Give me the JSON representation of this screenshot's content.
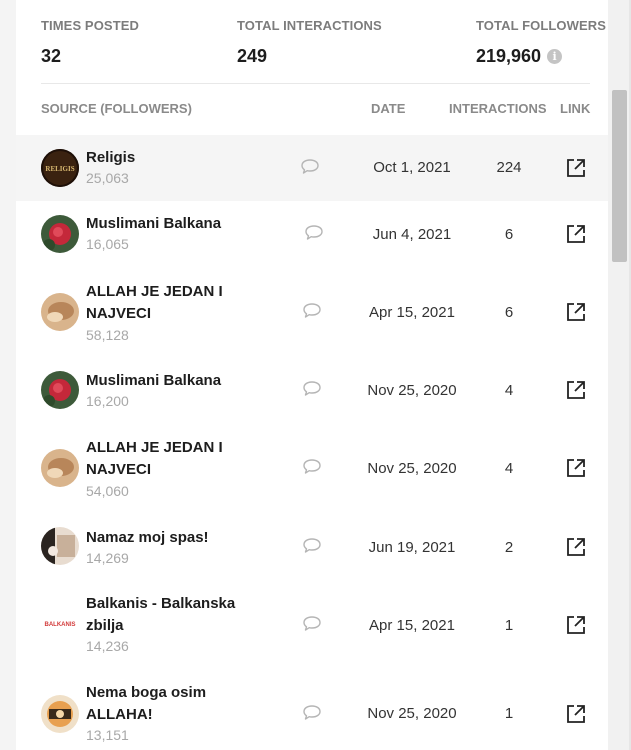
{
  "stats": {
    "times_posted_label": "TIMES POSTED",
    "times_posted_value": "32",
    "total_interactions_label": "TOTAL INTERACTIONS",
    "total_interactions_value": "249",
    "total_followers_label": "TOTAL FOLLOWERS",
    "total_followers_value": "219,960"
  },
  "table": {
    "headers": {
      "source": "SOURCE (FOLLOWERS)",
      "date": "DATE",
      "interactions": "INTERACTIONS",
      "link": "LINK"
    },
    "rows": [
      {
        "name": "Religis",
        "followers": "25,063",
        "date": "Oct 1, 2021",
        "interactions": "224",
        "avatar": "religis-avatar",
        "avatar_text": "RELIGIS"
      },
      {
        "name": "Muslimani Balkana",
        "followers": "16,065",
        "date": "Jun 4, 2021",
        "interactions": "6",
        "avatar": "rose-avatar"
      },
      {
        "name": "ALLAH JE JEDAN I NAJVECI",
        "followers": "58,128",
        "date": "Apr 15, 2021",
        "interactions": "6",
        "avatar": "tan-avatar"
      },
      {
        "name": "Muslimani Balkana",
        "followers": "16,200",
        "date": "Nov 25, 2020",
        "interactions": "4",
        "avatar": "rose-avatar"
      },
      {
        "name": "ALLAH JE JEDAN I NAJVECI",
        "followers": "54,060",
        "date": "Nov 25, 2020",
        "interactions": "4",
        "avatar": "tan-avatar"
      },
      {
        "name": "Namaz moj spas!",
        "followers": "14,269",
        "date": "Jun 19, 2021",
        "interactions": "2",
        "avatar": "prayer-avatar"
      },
      {
        "name": "Balkanis - Balkanska zbilja",
        "followers": "14,236",
        "date": "Apr 15, 2021",
        "interactions": "1",
        "avatar": "balkanis-avatar",
        "avatar_text": "BALKANIS"
      },
      {
        "name": "Nema boga osim ALLAHA!",
        "followers": "13,151",
        "date": "Nov 25, 2020",
        "interactions": "1",
        "avatar": "badge-avatar"
      }
    ]
  },
  "icons": {
    "info": "info-icon",
    "comment": "comment-icon",
    "external_link": "external-link-icon"
  },
  "colors": {
    "highlight_row": "#f5f5f5",
    "muted_text": "#a8a8a8",
    "header_text": "#8a8a8a"
  }
}
